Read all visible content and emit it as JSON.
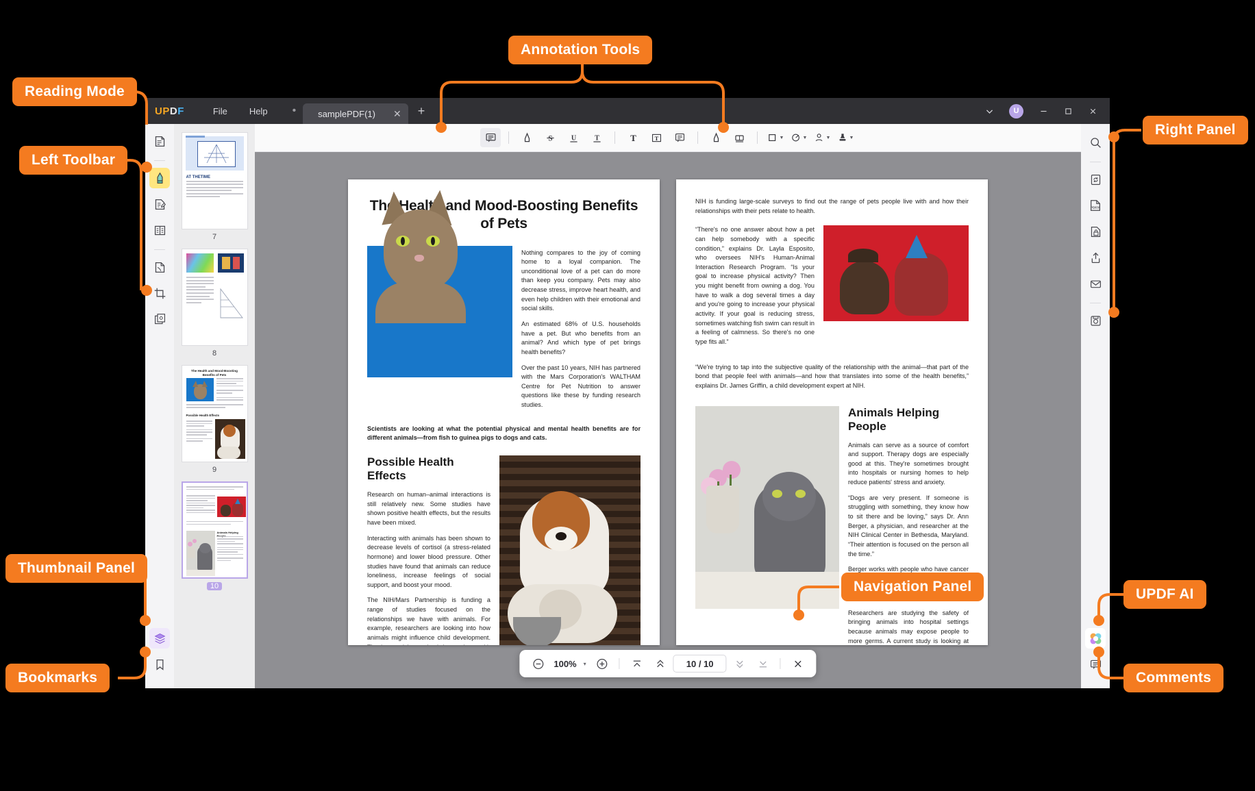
{
  "callouts": [
    {
      "id": "reading-mode",
      "label": "Reading Mode"
    },
    {
      "id": "left-toolbar",
      "label": "Left Toolbar"
    },
    {
      "id": "annotation-tools",
      "label": "Annotation Tools"
    },
    {
      "id": "right-panel",
      "label": "Right Panel"
    },
    {
      "id": "thumbnail-panel",
      "label": "Thumbnail Panel"
    },
    {
      "id": "bookmarks",
      "label": "Bookmarks"
    },
    {
      "id": "updf-ai",
      "label": "UPDF AI"
    },
    {
      "id": "comments",
      "label": "Comments"
    },
    {
      "id": "navigation-panel",
      "label": "Navigation Panel"
    }
  ],
  "colors": {
    "accent": "#F47B20",
    "titlebar": "#303034",
    "highlight": "#FFE680",
    "avatar": "#b9a6e8"
  },
  "titlebar": {
    "brand": {
      "p1": "UP",
      "p2": "D",
      "p3": "F",
      "p4": ""
    },
    "brand_text": "UPDF",
    "menus": [
      {
        "label": "File"
      },
      {
        "label": "Help"
      }
    ],
    "tab_dot": "•",
    "tab": {
      "title": "samplePDF(1)",
      "close": "✕"
    },
    "new_tab": "+",
    "window": {
      "chevron": "⌄",
      "avatar": "U",
      "minimize": "—",
      "maximize": "□",
      "close": "✕"
    }
  },
  "left_toolbar": {
    "items": [
      {
        "name": "reading-mode",
        "tip": "Reader"
      },
      {
        "name": "annotate-highlight",
        "tip": "Comment",
        "active": true
      },
      {
        "name": "edit-pdf",
        "tip": "Edit PDF"
      },
      {
        "name": "organize-pages",
        "tip": "Organize Pages"
      },
      {
        "name": "convert-pdf",
        "tip": "Convert PDF"
      },
      {
        "name": "crop-page",
        "tip": "Crop"
      },
      {
        "name": "page-tools",
        "tip": "Batch"
      }
    ],
    "bottom": [
      {
        "name": "layers",
        "tip": "Layers"
      },
      {
        "name": "bookmarks",
        "tip": "Bookmarks"
      }
    ]
  },
  "annotation_toolbar": {
    "items": [
      {
        "name": "sticky-note",
        "glyph": "note",
        "active": true
      },
      {
        "name": "highlight",
        "glyph": "highlighter"
      },
      {
        "name": "strikethrough",
        "glyph": "S"
      },
      {
        "name": "underline",
        "glyph": "U"
      },
      {
        "name": "squiggly",
        "glyph": "T"
      },
      {
        "name": "text-box",
        "glyph": "T"
      },
      {
        "name": "text-callout",
        "glyph": "T-box"
      },
      {
        "name": "text-comment",
        "glyph": "note-lines"
      },
      {
        "name": "pencil",
        "glyph": "pen"
      },
      {
        "name": "eraser",
        "glyph": "eraser"
      },
      {
        "name": "shapes",
        "glyph": "square",
        "caret": true
      },
      {
        "name": "stickers",
        "glyph": "pie",
        "caret": true
      },
      {
        "name": "signature",
        "glyph": "person",
        "caret": true
      },
      {
        "name": "stamp",
        "glyph": "stamp",
        "caret": true
      }
    ]
  },
  "right_panel": {
    "items": [
      {
        "name": "search",
        "tip": "Search"
      },
      {
        "name": "ocr",
        "tip": "OCR"
      },
      {
        "name": "pdf-a",
        "tip": "PDF/A",
        "text": "PDF/A"
      },
      {
        "name": "protect",
        "tip": "Protect"
      },
      {
        "name": "share",
        "tip": "Share"
      },
      {
        "name": "email",
        "tip": "Email"
      },
      {
        "name": "save-as",
        "tip": "Save As"
      }
    ],
    "bottom": [
      {
        "name": "updf-ai",
        "tip": "UPDF AI"
      },
      {
        "name": "comments",
        "tip": "Comments"
      }
    ]
  },
  "thumbnails": [
    {
      "page": "7",
      "selected": false
    },
    {
      "page": "8",
      "selected": false
    },
    {
      "page": "9",
      "selected": false
    },
    {
      "page": "10",
      "selected": true
    }
  ],
  "navigation": {
    "zoom_out": "−",
    "zoom_level": "100%",
    "zoom_caret": "▾",
    "zoom_in": "+",
    "first_page": "first",
    "prev_page": "prev",
    "page_indicator": "10 / 10",
    "next_page": "next",
    "last_page": "last",
    "close": "✕"
  },
  "document": {
    "left_page": {
      "title": "The Health and Mood-Boosting Benefits of Pets",
      "paragraphs": [
        "Nothing compares to the joy of coming home to a loyal companion. The unconditional love of a pet can do more than keep you company. Pets may also decrease stress, improve heart health,  and  even  help children  with  their emotional and social skills.",
        "An estimated 68% of U.S. households have a pet. But who benefits from an animal? And which type of pet brings health benefits?",
        "Over  the  past  10  years,  NIH  has partnered with the Mars Corporation's WALTHAM Centre for  Pet  Nutrition  to answer  questions  like these by funding research studies."
      ],
      "caption": "Scientists are looking at what the potential physical and mental health benefits are for different animals—from fish to guinea pigs to dogs and cats.",
      "section_title": "Possible Health Effects",
      "section_paragraphs": [
        "Research  on  human–animal  interactions is  still  relatively  new.  Some  studies  have shown  positive  health  effects,  but  the results have been mixed.",
        "Interacting with animals has been shown to decrease levels of cortisol (a stress-related hormone) and lower blood pressure. Other studies have found that animals can reduce loneliness,  increase  feelings  of social support, and boost your mood.",
        "The  NIH/Mars  Partnership  is  funding  a range  of  studies  focused  on  the relationships  we  have  with  animals.  For example, researchers are looking into how animals might influence child development. They're  studying  animal  interactions  with kids  who  have  autism,  attention  deficit hyperactivity  disorder  (ADHD),  and  other conditions."
      ]
    },
    "right_page": {
      "intro": "NIH  is  funding  large-scale  surveys  to  find  out  the  range  of  pets  people  live  with  and  how their relationships with their pets relate to health.",
      "quote1": "“There's no one answer about how a pet can help somebody with a  specific condition,” explains  Dr.  Layla  Esposito,  who oversees NIH's Human-Animal  Interaction Research Program. “Is your goal to increase physical activity? Then you might benefit from owning a dog. You have to walk a dog several times a day and you're going to increase your physical activity.  If your goal is reducing stress, sometimes watching fish swim can result in a feeling of calmness. So there's no one type fits all.”",
      "quote2": "“We're trying to tap into the subjective quality of the relationship with the animal—that part of the bond that people feel with animals—and how that translates into some of the health benefits,” explains Dr. James Griffin, a child development expert at NIH.",
      "section_title": "Animals Helping People",
      "section_paragraphs": [
        "Animals can serve as a source of comfort and support. Therapy dogs are especially good at this. They're sometimes brought into hospitals or nursing homes to help reduce patients' stress and anxiety.",
        "“Dogs are very present. If someone is struggling with something, they know how to sit there and be loving,”  says  Dr.  Ann Berger,  a  physician, and researcher at the NIH Clinical Center in Bethesda, Maryland. “Their  attention  is  focused  on  the person all the time.”",
        "Berger works with people who have cancer and terminal illnesses.  She  teaches  them about mindfulness to help decrease stress and manage pain.",
        "Researchers are studying the safety of bringing animals into hospital settings because animals may expose people to more germs. A current study is looking at the safety of bringing dogs to visit children with cancer,  Esposito says. Scientists will be testing the children's hands to see if there are dangerous levels of  germs transferred from the dog after the visit."
      ]
    }
  }
}
